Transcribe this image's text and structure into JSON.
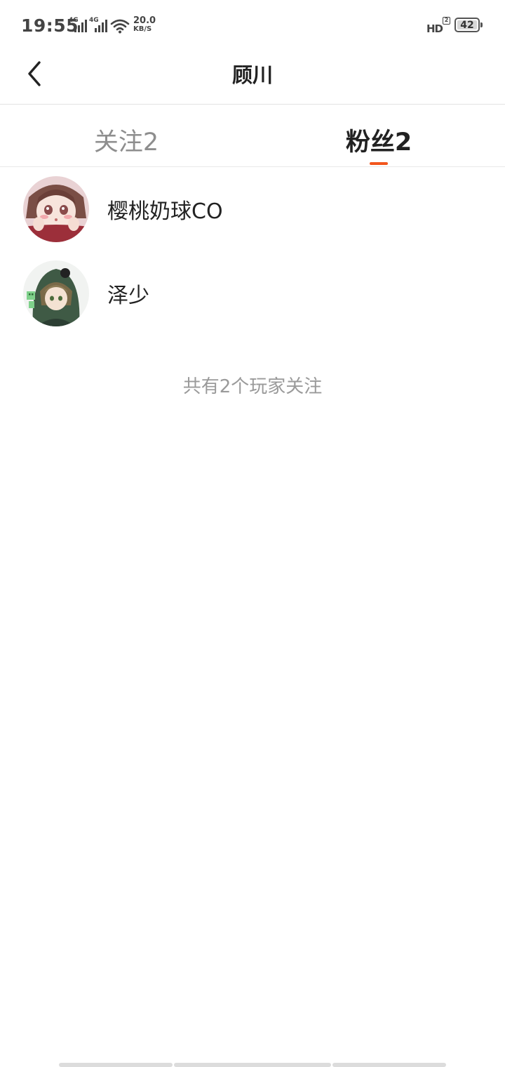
{
  "status_bar": {
    "time": "19:55",
    "signal_1_label": "4G",
    "signal_2_label": "4G",
    "speed_value": "20.0",
    "speed_unit": "KB/S",
    "hd_label": "HD",
    "hd_sim": "2",
    "battery_level": "42"
  },
  "header": {
    "title": "顾川"
  },
  "tabs": [
    {
      "label": "关注2",
      "active": false
    },
    {
      "label": "粉丝2",
      "active": true
    }
  ],
  "accent_color": "#f2561d",
  "users": [
    {
      "name": "樱桃奶球CO"
    },
    {
      "name": "泽少"
    }
  ],
  "footer_note": "共有2个玩家关注"
}
